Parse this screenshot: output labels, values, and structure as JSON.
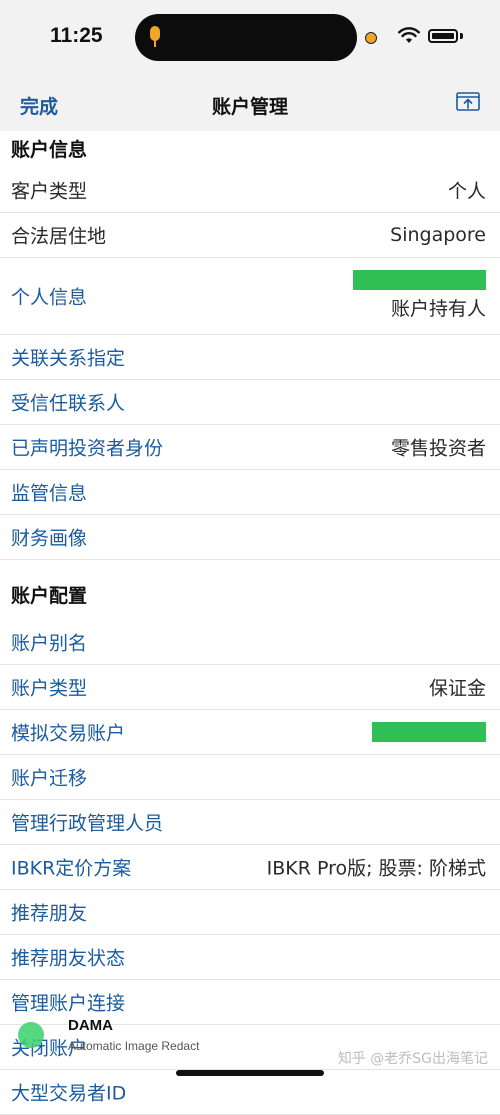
{
  "status": {
    "time": "11:25"
  },
  "nav": {
    "done": "完成",
    "title": "账户管理"
  },
  "account_info": {
    "title": "账户信息",
    "rows": [
      {
        "label": "客户类型",
        "value": "个人",
        "link": false
      },
      {
        "label": "合法居住地",
        "value": "Singapore",
        "link": false
      },
      {
        "label": "个人信息",
        "value": "账户持有人",
        "link": true
      },
      {
        "label": "关联关系指定",
        "value": "",
        "link": true
      },
      {
        "label": "受信任联系人",
        "value": "",
        "link": true
      },
      {
        "label": "已声明投资者身份",
        "value": "零售投资者",
        "link": true
      },
      {
        "label": "监管信息",
        "value": "",
        "link": true
      },
      {
        "label": "财务画像",
        "value": "",
        "link": true
      }
    ]
  },
  "account_config": {
    "title": "账户配置",
    "rows": [
      {
        "label": "账户别名",
        "value": "",
        "link": true
      },
      {
        "label": "账户类型",
        "value": "保证金",
        "link": true
      },
      {
        "label": "模拟交易账户",
        "value": "",
        "link": true
      },
      {
        "label": "账户迁移",
        "value": "",
        "link": true
      },
      {
        "label": "管理行政管理人员",
        "value": "",
        "link": true
      },
      {
        "label": "IBKR定价方案",
        "value": "IBKR Pro版; 股票: 阶梯式",
        "link": true
      },
      {
        "label": "推荐朋友",
        "value": "",
        "link": true
      },
      {
        "label": "推荐朋友状态",
        "value": "",
        "link": true
      },
      {
        "label": "管理账户连接",
        "value": "",
        "link": true
      },
      {
        "label": "关闭账户",
        "value": "",
        "link": true
      },
      {
        "label": "大型交易者ID",
        "value": "",
        "link": true
      }
    ]
  },
  "watermark": {
    "brand": "DAMA",
    "subtitle": "Automatic Image Redact",
    "source": "知乎 @老乔SG出海笔记"
  },
  "colors": {
    "link": "#1b5b9e",
    "redaction": "#2fbf55",
    "header_bg": "#f2f2f2"
  }
}
